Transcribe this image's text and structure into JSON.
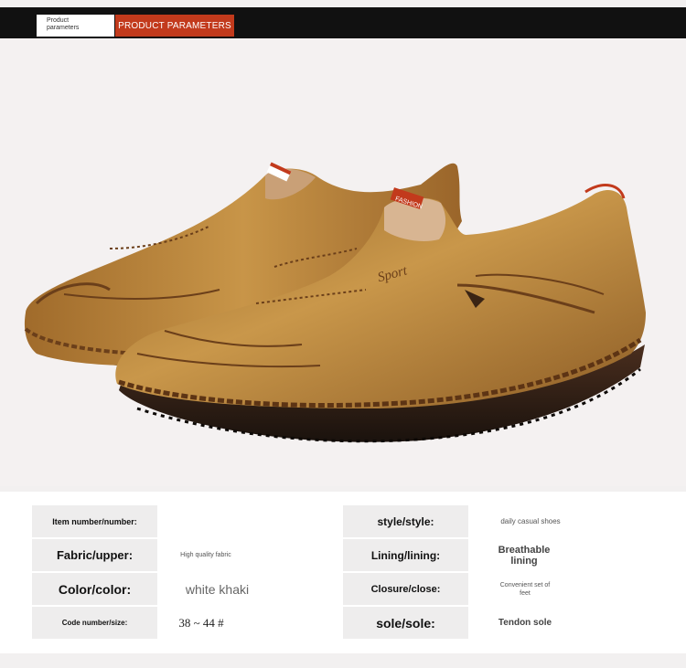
{
  "header": {
    "tab_small": "Product\nparameters",
    "tab_title": "PRODUCT PARAMETERS"
  },
  "product_image": {
    "tongue_label": "FASHION",
    "side_logo": "Sport"
  },
  "params": {
    "left": [
      {
        "label": "Item number/number:",
        "value": ""
      },
      {
        "label": "Fabric/upper:",
        "value": "High quality fabric"
      },
      {
        "label": "Color/color:",
        "value": "white khaki"
      },
      {
        "label": "Code number/size:",
        "value": "38 ~ 44 #"
      }
    ],
    "right": [
      {
        "label": "style/style:",
        "value": "daily casual shoes"
      },
      {
        "label": "Lining/lining:",
        "value": "Breathable lining"
      },
      {
        "label": "Closure/close:",
        "value": "Convenient set of feet"
      },
      {
        "label": "sole/sole:",
        "value": "Tendon sole"
      }
    ]
  },
  "colors": {
    "accent": "#c23a1c",
    "shoe_leather": "#b8843c",
    "sole": "#2a1d16"
  }
}
